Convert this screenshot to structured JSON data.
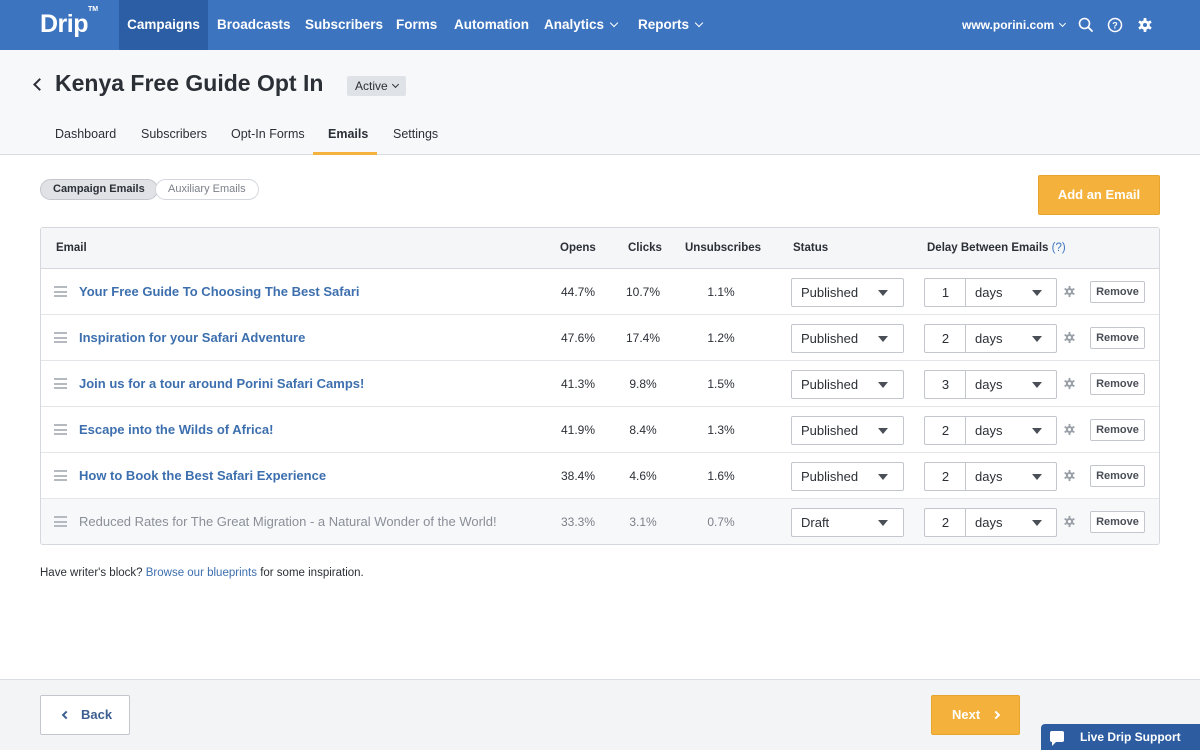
{
  "brand": {
    "logo_text": "Drip",
    "logo_mark": "TM",
    "nav_color": "#3d74bf",
    "accent": "#f4b23d"
  },
  "nav": {
    "items": [
      {
        "label": "Campaigns",
        "active": true
      },
      {
        "label": "Broadcasts"
      },
      {
        "label": "Subscribers"
      },
      {
        "label": "Forms"
      },
      {
        "label": "Automation"
      },
      {
        "label": "Analytics",
        "dropdown": true
      },
      {
        "label": "Reports",
        "dropdown": true
      }
    ],
    "account": "www.porini.com",
    "icons": [
      "search-icon",
      "help-icon",
      "gear-icon"
    ]
  },
  "header": {
    "title": "Kenya Free Guide Opt In",
    "status": "Active",
    "tabs": [
      "Dashboard",
      "Subscribers",
      "Opt-In Forms",
      "Emails",
      "Settings"
    ],
    "active_tab": "Emails"
  },
  "toggle": {
    "campaign": "Campaign Emails",
    "auxiliary": "Auxiliary Emails",
    "selected": "Campaign Emails"
  },
  "add_button": "Add an Email",
  "table": {
    "columns": {
      "email": "Email",
      "opens": "Opens",
      "clicks": "Clicks",
      "unsubscribes": "Unsubscribes",
      "status": "Status",
      "delay": "Delay Between Emails",
      "delay_help": "(?)"
    },
    "rows": [
      {
        "email": "Your Free Guide To Choosing The Best Safari",
        "opens": "44.7%",
        "clicks": "10.7%",
        "unsubscribes": "1.1%",
        "status": "Published",
        "delay": "1",
        "unit": "days",
        "remove": "Remove"
      },
      {
        "email": "Inspiration for your Safari Adventure",
        "opens": "47.6%",
        "clicks": "17.4%",
        "unsubscribes": "1.2%",
        "status": "Published",
        "delay": "2",
        "unit": "days",
        "remove": "Remove"
      },
      {
        "email": "Join us for a tour around Porini Safari Camps!",
        "opens": "41.3%",
        "clicks": "9.8%",
        "unsubscribes": "1.5%",
        "status": "Published",
        "delay": "3",
        "unit": "days",
        "remove": "Remove"
      },
      {
        "email": "Escape into the Wilds of Africa!",
        "opens": "41.9%",
        "clicks": "8.4%",
        "unsubscribes": "1.3%",
        "status": "Published",
        "delay": "2",
        "unit": "days",
        "remove": "Remove"
      },
      {
        "email": "How to Book the Best Safari Experience",
        "opens": "38.4%",
        "clicks": "4.6%",
        "unsubscribes": "1.6%",
        "status": "Published",
        "delay": "2",
        "unit": "days",
        "remove": "Remove"
      },
      {
        "email": "Reduced Rates for The Great Migration - a Natural Wonder of the World!",
        "opens": "33.3%",
        "clicks": "3.1%",
        "unsubscribes": "0.7%",
        "status": "Draft",
        "delay": "2",
        "unit": "days",
        "remove": "Remove"
      }
    ]
  },
  "note": {
    "prefix": "Have writer's block?",
    "link": "Browse our blueprints",
    "suffix": "for some inspiration."
  },
  "footer": {
    "back": "Back",
    "next": "Next",
    "support": "Live Drip Support"
  }
}
